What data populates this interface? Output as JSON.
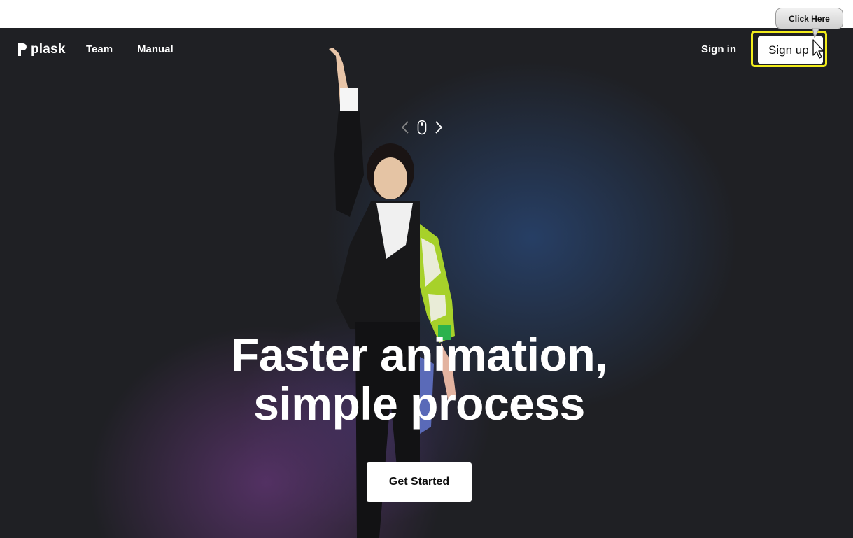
{
  "nav": {
    "logo_text": "plask",
    "links": {
      "team": "Team",
      "manual": "Manual"
    },
    "sign_in": "Sign in",
    "sign_up": "Sign up"
  },
  "tooltip": {
    "text": "Click Here"
  },
  "hero": {
    "headline_line1": "Faster animation,",
    "headline_line2": "simple process",
    "cta": "Get Started"
  },
  "colors": {
    "hero_background": "#1f2024",
    "highlight": "#f2ec1c",
    "button_bg": "#ffffff"
  },
  "icons": [
    "plask-logo-icon",
    "chevron-left-icon",
    "mouse-icon",
    "chevron-right-icon",
    "mouse-cursor-icon"
  ]
}
